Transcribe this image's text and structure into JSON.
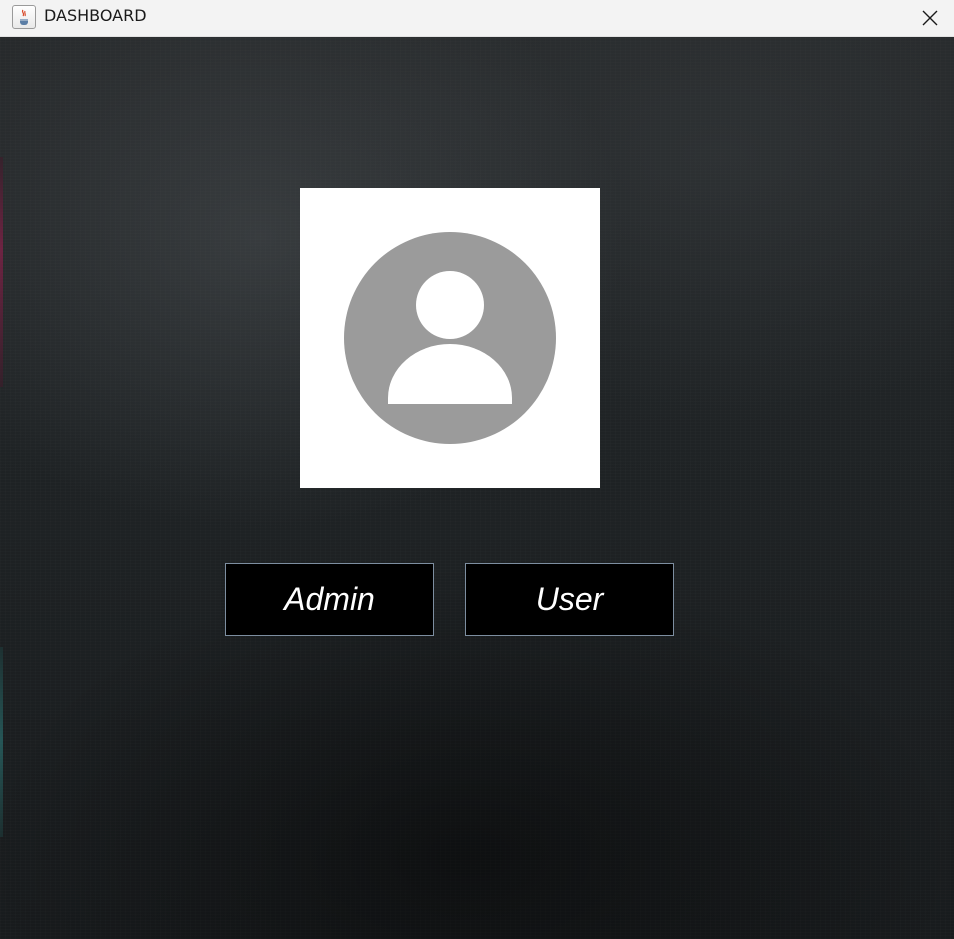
{
  "window": {
    "title": "DASHBOARD",
    "app_icon": "java-cup-icon",
    "close_icon": "close-icon"
  },
  "main": {
    "avatar_icon": "user-avatar-icon",
    "buttons": {
      "admin_label": "Admin",
      "user_label": "User"
    }
  },
  "colors": {
    "titlebar_bg": "#f3f3f3",
    "background": "#1f2325",
    "avatar_card_bg": "#ffffff",
    "avatar_gray": "#9b9b9b",
    "button_bg": "#000000",
    "button_border": "#7d8ea0",
    "button_text": "#ffffff"
  }
}
